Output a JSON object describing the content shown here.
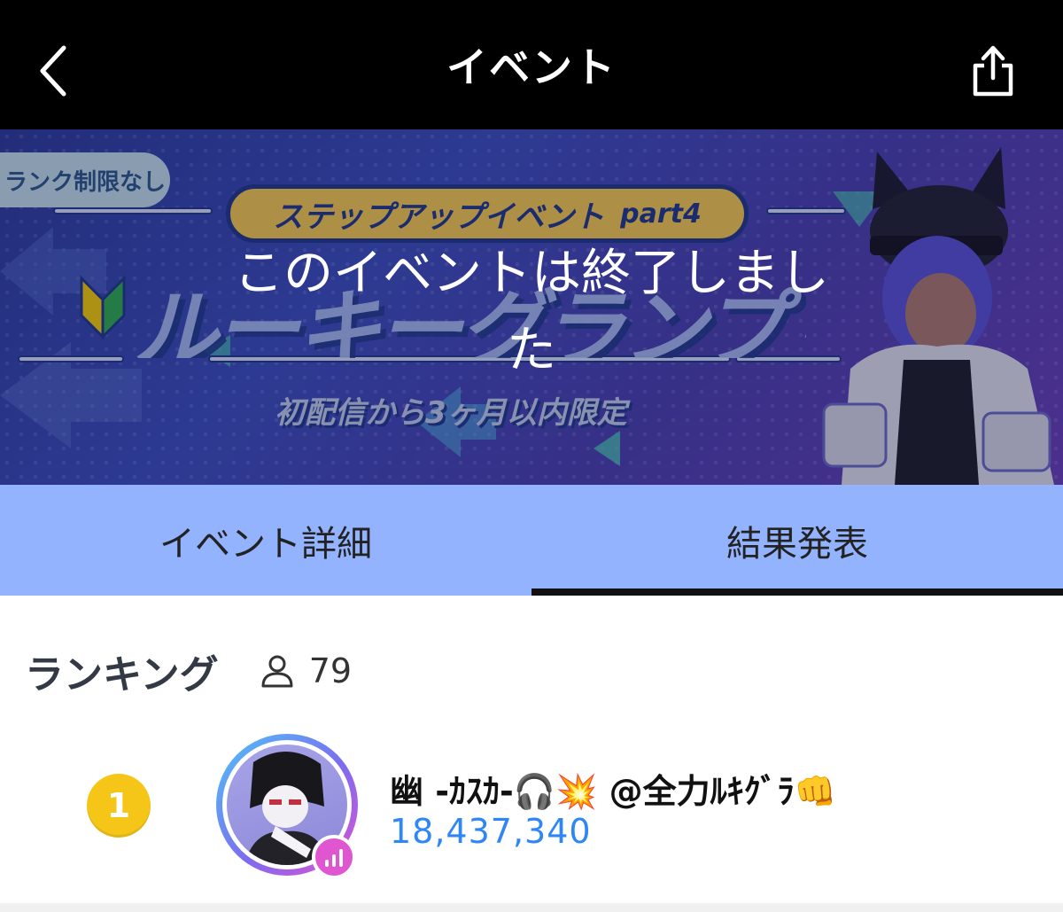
{
  "header": {
    "title": "イベント",
    "back_icon": "chevron-left-icon",
    "share_icon": "share-icon"
  },
  "banner": {
    "rank_badge": "ランク制限なし",
    "event_series": "ステップアップイベント",
    "event_part": "part4",
    "event_name": "ルーキーグランプリ",
    "subtitle": "初配信から3ヶ月以内限定",
    "ended_message": "このイベントは終了しました"
  },
  "tabs": [
    {
      "label": "イベント詳細",
      "active": false
    },
    {
      "label": "結果発表",
      "active": true
    }
  ],
  "ranking": {
    "title": "ランキング",
    "participants": "79",
    "entries": [
      {
        "rank": "1",
        "name": "幽 -ｶｽｶ-🎧💥 @全力ﾙｷｸﾞﾗ👊",
        "score": "18,437,340"
      }
    ]
  },
  "colors": {
    "tab_bg": "#93b3ff",
    "medal_gold": "#f5c518",
    "score_blue": "#2f86f6",
    "live_pink": "#e056d0"
  }
}
